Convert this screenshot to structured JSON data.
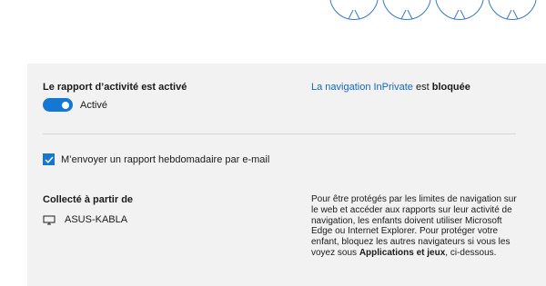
{
  "activity": {
    "title": "Le rapport d’activité est activé",
    "toggle_label": "Activé"
  },
  "inprivate": {
    "link_text": "La navigation InPrivate",
    "middle_text": " est ",
    "status_text": "bloquée"
  },
  "weekly_email": {
    "label": "M’envoyer un rapport hebdomadaire par e-mail"
  },
  "collected": {
    "title": "Collecté à partir de",
    "device_name": "ASUS-KABLA"
  },
  "info": {
    "text_1": "Pour être protégés par les limites de navigation sur le web et accéder aux rapports sur leur activité de navigation, les enfants doivent utiliser Microsoft Edge ou Internet Explorer. Pour protéger votre enfant, bloquez les autres navigateurs si vous les voyez sous ",
    "bold_text": "Applications et jeux",
    "text_2": ", ci-dessous."
  },
  "colors": {
    "accent": "#1477d4",
    "link": "#1266c0",
    "panel_bg": "#f2f2f2"
  },
  "icons": {
    "avatar": "person-outline-icon",
    "device": "monitor-icon",
    "check": "check-icon"
  }
}
